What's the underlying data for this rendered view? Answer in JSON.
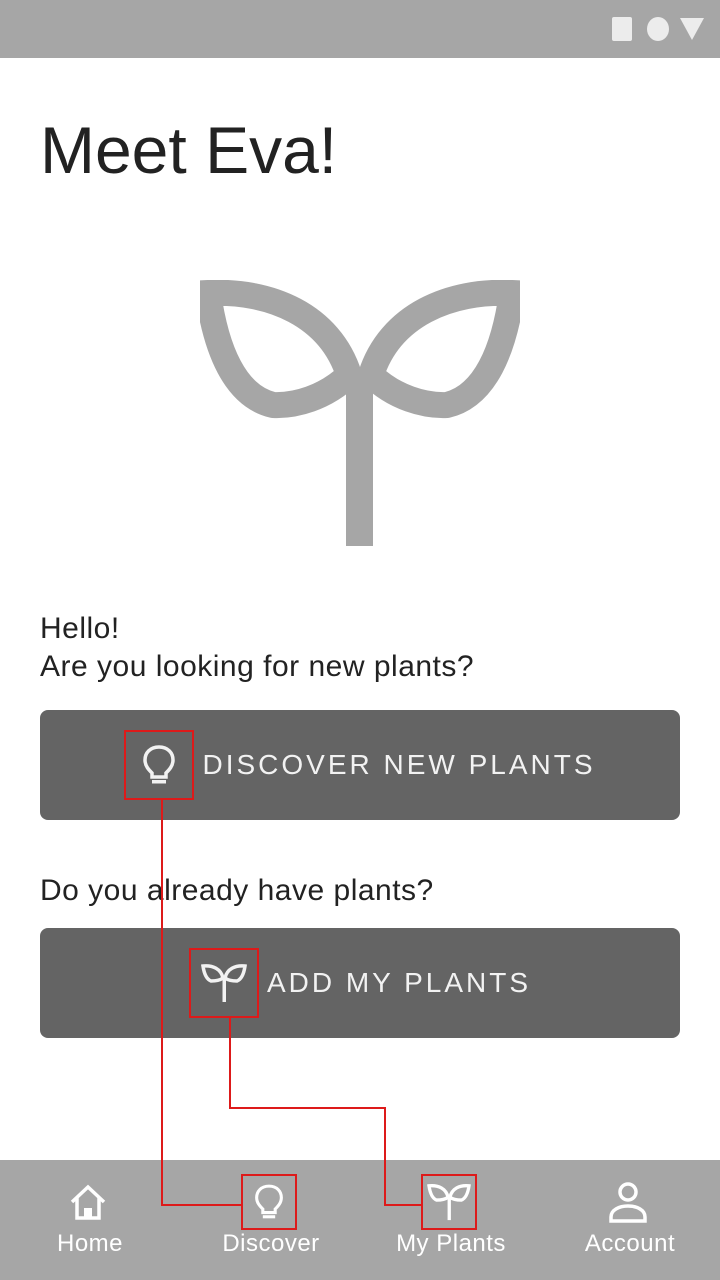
{
  "title": "Meet Eva!",
  "greeting": {
    "hello": "Hello!",
    "question": "Are you looking for new plants?"
  },
  "discover_button": {
    "label": "DISCOVER NEW PLANTS",
    "icon": "lightbulb-icon"
  },
  "have_plants_question": "Do you already have plants?",
  "add_button": {
    "label": "ADD MY PLANTS",
    "icon": "sprout-icon"
  },
  "nav": {
    "items": [
      {
        "label": "Home",
        "icon": "home-icon"
      },
      {
        "label": "Discover",
        "icon": "lightbulb-icon"
      },
      {
        "label": "My Plants",
        "icon": "sprout-icon"
      },
      {
        "label": "Account",
        "icon": "person-icon"
      }
    ]
  },
  "colors": {
    "status_bar": "#a6a6a6",
    "button_bg": "#646464",
    "nav_bg": "#a6a6a6",
    "hero_icon": "#a6a6a6",
    "annotation": "#dd1a1a"
  }
}
